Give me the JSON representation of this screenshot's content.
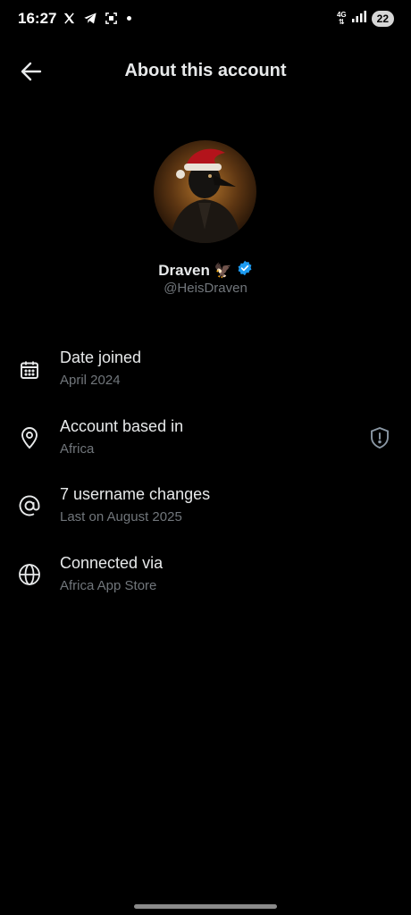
{
  "status_bar": {
    "time": "16:27",
    "network": "4G",
    "battery": "22",
    "icons": [
      "x-icon",
      "telegram-icon",
      "screenshot-icon",
      "notification-dot"
    ]
  },
  "header": {
    "title": "About this account",
    "back_icon": "arrow-left-icon"
  },
  "profile": {
    "display_name": "Draven",
    "name_emoji": "🦅",
    "verified": true,
    "handle": "@HeisDraven"
  },
  "details": [
    {
      "icon": "calendar-icon",
      "title": "Date joined",
      "subtitle": "April 2024"
    },
    {
      "icon": "location-pin-icon",
      "title": "Account based in",
      "subtitle": "Africa",
      "trailing_icon": "shield-alert-icon"
    },
    {
      "icon": "at-sign-icon",
      "title": "7 username changes",
      "subtitle": "Last on August 2025"
    },
    {
      "icon": "globe-icon",
      "title": "Connected via",
      "subtitle": "Africa App Store"
    }
  ],
  "colors": {
    "background": "#000000",
    "primary_text": "#e7e9ea",
    "secondary_text": "#71767b",
    "verified_badge": "#1d9bf0"
  }
}
